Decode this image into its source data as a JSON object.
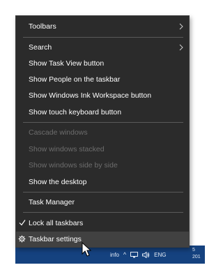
{
  "menu": {
    "toolbars": "Toolbars",
    "search": "Search",
    "task_view": "Show Task View button",
    "people": "Show People on the taskbar",
    "ink": "Show Windows Ink Workspace button",
    "touch_keyboard": "Show touch keyboard button",
    "cascade": "Cascade windows",
    "stacked": "Show windows stacked",
    "side_by_side": "Show windows side by side",
    "desktop": "Show the desktop",
    "task_manager": "Task Manager",
    "lock_taskbars": "Lock all taskbars",
    "taskbar_settings": "Taskbar settings"
  },
  "taskbar": {
    "info": "info",
    "lang": "ENG",
    "clock_line1": "5",
    "clock_line2": "201"
  },
  "colors": {
    "menu_bg": "#2b2b2b",
    "hover_bg": "#414141",
    "disabled_text": "#6d6d6d",
    "taskbar_bg": "#15427f"
  }
}
